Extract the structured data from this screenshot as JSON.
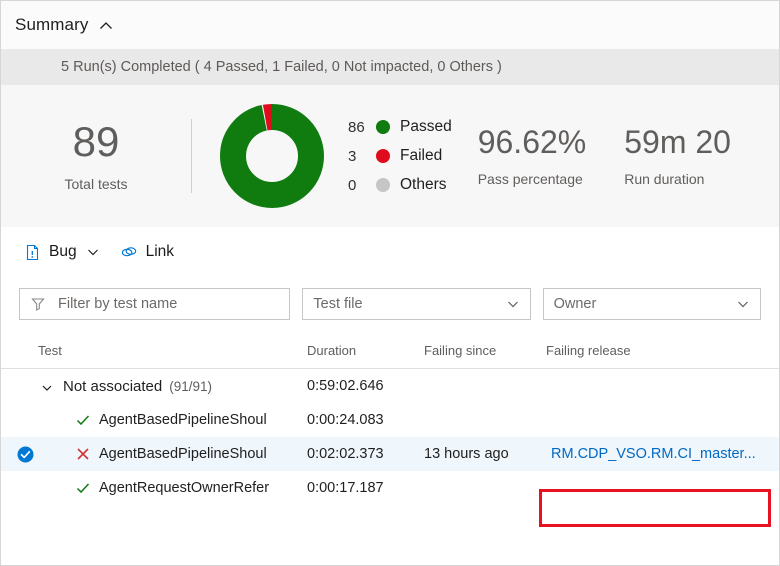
{
  "summary": {
    "title": "Summary",
    "collapse_icon": "chevron-up-icon",
    "runs_text": "5 Run(s) Completed ( 4 Passed, 1 Failed, 0 Not impacted, 0 Others )"
  },
  "stats": {
    "total": {
      "value": "89",
      "caption": "Total tests"
    },
    "pass_percentage": {
      "value": "96.62%",
      "caption": "Pass percentage"
    },
    "run_duration": {
      "value": "59m 20",
      "caption": "Run duration"
    }
  },
  "chart_data": {
    "type": "pie",
    "title": "",
    "categories": [
      "Passed",
      "Failed",
      "Others"
    ],
    "values": [
      86,
      3,
      0
    ],
    "colors": [
      "#107c10",
      "#e00b1c",
      "#c8c6c4"
    ],
    "legend_position": "right",
    "donut": true,
    "total": 89,
    "pass_percentage": 96.62
  },
  "legend": [
    {
      "count": "86",
      "label": "Passed",
      "color": "#107c10"
    },
    {
      "count": "3",
      "label": "Failed",
      "color": "#e00b1c"
    },
    {
      "count": "0",
      "label": "Others",
      "color": "#c8c6c4"
    }
  ],
  "toolbar": {
    "bug_label": "Bug",
    "bug_icon": "bug-document-icon",
    "bug_caret_icon": "chevron-down-icon",
    "link_label": "Link",
    "link_icon": "link-icon"
  },
  "filters": {
    "test_name_placeholder": "Filter by test name",
    "test_name_value": "",
    "funnel_icon": "filter-funnel-icon",
    "test_file_label": "Test file",
    "owner_label": "Owner",
    "caret_icon": "chevron-down-icon"
  },
  "table": {
    "columns": [
      "Test",
      "Duration",
      "Failing since",
      "Failing release"
    ],
    "rows": [
      {
        "kind": "group",
        "caret_icon": "chevron-down-icon",
        "test": "Not associated",
        "count": "(91/91)",
        "duration": "0:59:02.646",
        "failing_since": "",
        "failing_release": "",
        "selected": false
      },
      {
        "kind": "test",
        "status_icon": "check-icon",
        "test": "AgentBasedPipelineShoul",
        "duration": "0:00:24.083",
        "failing_since": "",
        "failing_release": "",
        "selected": false
      },
      {
        "kind": "test",
        "status_icon": "x-icon",
        "test": "AgentBasedPipelineShoul",
        "duration": "0:02:02.373",
        "failing_since": "13 hours ago",
        "failing_release": "RM.CDP_VSO.RM.CI_master...",
        "selected": true,
        "select_icon": "checked-circle-icon"
      },
      {
        "kind": "test",
        "status_icon": "check-icon",
        "test": "AgentRequestOwnerRefer",
        "duration": "0:00:17.187",
        "failing_since": "",
        "failing_release": "",
        "selected": false
      }
    ]
  },
  "annotation": {
    "highlight_color": "#e81123",
    "target": "failing-release-link"
  }
}
